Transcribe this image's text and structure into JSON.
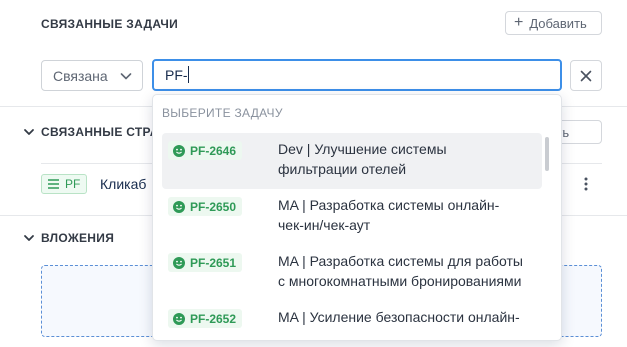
{
  "sections": {
    "related_tasks": {
      "title": "СВЯЗАННЫЕ ЗАДАЧИ",
      "add_label": "Добавить"
    },
    "linked_pages": {
      "title": "СВЯЗАННЫЕ СТРА",
      "add_label": "авить"
    },
    "attachments": {
      "title": "ВЛОЖЕНИЯ"
    }
  },
  "relation_select": {
    "value": "Связана"
  },
  "search": {
    "value": "PF-"
  },
  "linked_row": {
    "tag": "PF",
    "text": "Кликаб"
  },
  "dropdown": {
    "header": "ВЫБЕРИТЕ ЗАДАЧУ",
    "items": [
      {
        "id": "PF-2646",
        "line1": "Dev | Улучшение системы",
        "line2": "фильтрации отелей",
        "active": true
      },
      {
        "id": "PF-2650",
        "line1": "MA | Разработка системы онлайн-",
        "line2": "чек-ин/чек-аут",
        "active": false
      },
      {
        "id": "PF-2651",
        "line1": "MA | Разработка системы для работы",
        "line2": "с многокомнатными бронированиями",
        "active": false
      },
      {
        "id": "PF-2652",
        "line1": "MA | Усиление безопасности онлайн-",
        "line2": "",
        "active": false
      }
    ]
  },
  "colors": {
    "accent": "#3d8fe8",
    "status_green": "#2f9a57"
  }
}
